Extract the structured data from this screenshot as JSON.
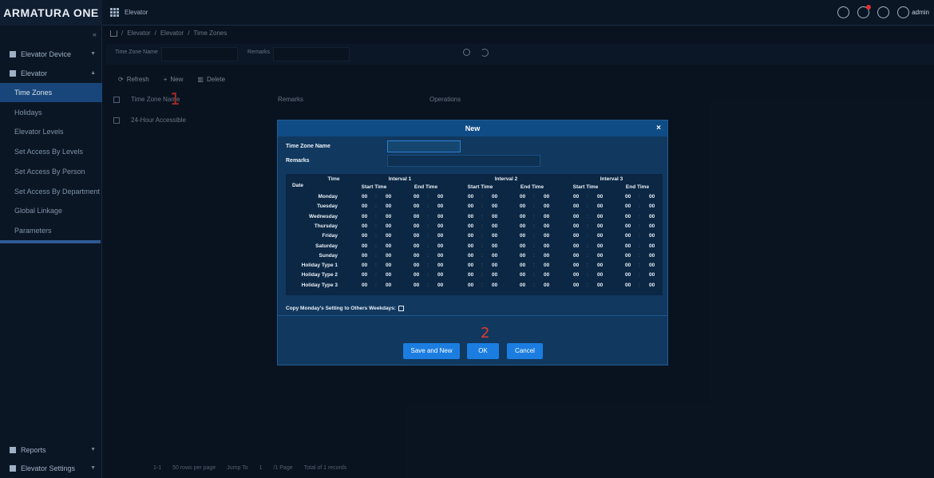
{
  "topbar": {
    "logo": "ARMATURA ONE",
    "app_name": "Elevator",
    "user": "admin",
    "icons": [
      "grid-icon",
      "message-icon",
      "notification-icon",
      "help-icon",
      "user-icon"
    ]
  },
  "sidebar": {
    "collapse_glyph": "«",
    "items": [
      {
        "label": "Elevator Device",
        "icon": "device-icon"
      },
      {
        "label": "Elevator",
        "icon": "elevator-icon"
      }
    ],
    "subitems": [
      {
        "label": "Time Zones",
        "active": true
      },
      {
        "label": "Holidays"
      },
      {
        "label": "Elevator Levels"
      },
      {
        "label": "Set Access By Levels"
      },
      {
        "label": "Set Access By Person"
      },
      {
        "label": "Set Access By Department"
      },
      {
        "label": "Global Linkage"
      },
      {
        "label": "Parameters"
      }
    ],
    "bottom": [
      {
        "label": "Reports",
        "icon": "reports-icon"
      },
      {
        "label": "Elevator Settings",
        "icon": "settings-icon"
      }
    ]
  },
  "breadcrumb": [
    "Elevator",
    "Elevator",
    "Time Zones"
  ],
  "filter": {
    "name_label": "Time Zone Name",
    "remarks_label": "Remarks"
  },
  "toolbar": {
    "refresh": "Refresh",
    "new": "New",
    "delete": "Delete"
  },
  "table": {
    "headers": [
      "Time Zone Name",
      "Remarks",
      "Operations"
    ],
    "rows": [
      {
        "name": "24-Hour Accessible"
      }
    ]
  },
  "footer": {
    "range": "1-1",
    "rows_per_page": "50 rows per page",
    "jump_label": "Jump To",
    "jump_value": "1",
    "page_info": "/1 Page",
    "total": "Total of 1 records"
  },
  "annotations": {
    "a1": "1",
    "a2": "2"
  },
  "dialog": {
    "title": "New",
    "close": "×",
    "name_label": "Time Zone Name",
    "remarks_label": "Remarks",
    "time_header": "Time",
    "date_header": "Date",
    "intervals": [
      "Interval 1",
      "Interval 2",
      "Interval 3"
    ],
    "start_label": "Start Time",
    "end_label": "End Time",
    "days": [
      "Monday",
      "Tuesday",
      "Wednesday",
      "Thursday",
      "Friday",
      "Saturday",
      "Sunday",
      "Holiday Type 1",
      "Holiday Type 2",
      "Holiday Type 3"
    ],
    "default_value": "00",
    "separator": ":",
    "copy_label": "Copy Monday's Setting to Others Weekdays:",
    "buttons": {
      "save_new": "Save and New",
      "ok": "OK",
      "cancel": "Cancel"
    }
  }
}
